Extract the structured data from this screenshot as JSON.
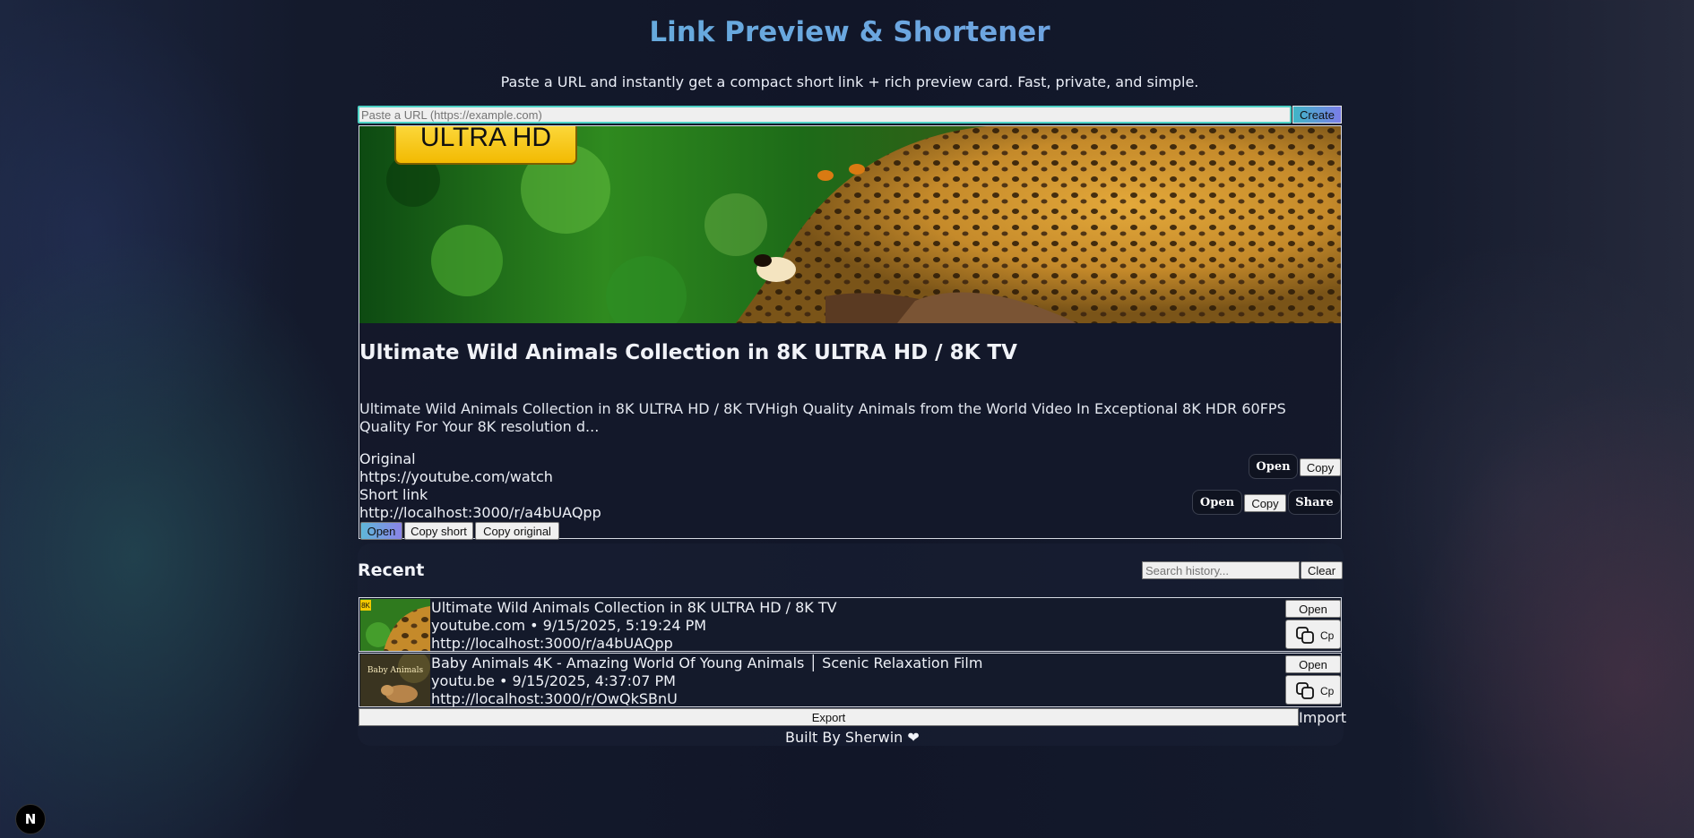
{
  "header": {
    "title": "Link Preview & Shortener",
    "subtitle": "Paste a URL and instantly get a compact short link + rich preview card. Fast, private, and simple."
  },
  "url_form": {
    "placeholder": "Paste a URL (https://example.com)",
    "create_label": "Create"
  },
  "preview": {
    "image_badge": "ULTRA HD",
    "title": "Ultimate Wild Animals Collection in 8K ULTRA HD / 8K TV",
    "description": "Ultimate Wild Animals Collection in 8K ULTRA HD / 8K TVHigh Quality Animals from the World Video In Exceptional 8K HDR 60FPS Quality For Your 8K resolution d...",
    "original_label": "Original",
    "original_url": "https://youtube.com/watch",
    "short_label": "Short link",
    "short_url": "http://localhost:3000/r/a4bUAQpp",
    "original_open": "Open",
    "original_copy": "Copy",
    "short_open": "Open",
    "short_copy": "Copy",
    "short_share": "Share",
    "bottom_open": "Open",
    "bottom_copy_short": "Copy short",
    "bottom_copy_original": "Copy original"
  },
  "recent": {
    "title": "Recent",
    "search_placeholder": "Search history...",
    "clear_label": "Clear",
    "items": [
      {
        "title": "Ultimate Wild Animals Collection in 8K ULTRA HD / 8K TV",
        "meta": "youtube.com • 9/15/2025, 5:19:24 PM",
        "short_url": "http://localhost:3000/r/a4bUAQpp",
        "open_label": "Open",
        "copy_label": "Cp",
        "thumb_icon": "leopard-thumbnail"
      },
      {
        "title": "Baby Animals 4K - Amazing World Of Young Animals │ Scenic Relaxation Film",
        "meta": "youtu.be • 9/15/2025, 4:37:07 PM",
        "short_url": "http://localhost:3000/r/OwQkSBnU",
        "open_label": "Open",
        "copy_label": "Cp",
        "thumb_icon": "baby-animals-thumbnail",
        "thumb_text": "Baby Animals"
      }
    ],
    "export_label": "Export",
    "import_label": "Import"
  },
  "footer": {
    "text": "Built By Sherwin",
    "heart": "❤"
  },
  "dev_badge": "N",
  "colors": {
    "title_gradient_start": "#5ab3d6",
    "title_gradient_end": "#7b9be8",
    "accent_teal": "#4fd1c5",
    "background": "#111628"
  }
}
